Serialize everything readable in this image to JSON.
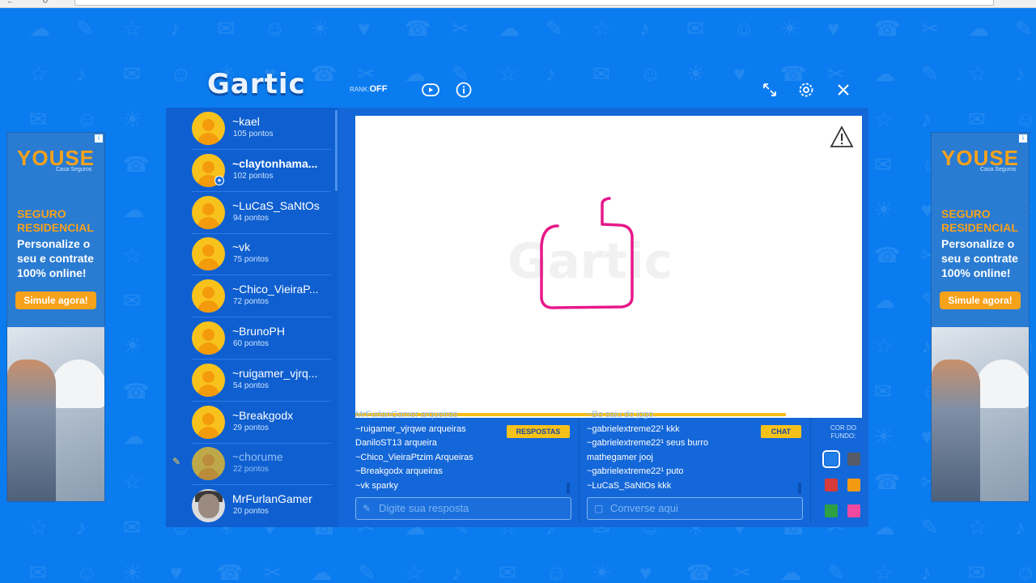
{
  "header": {
    "logo": "Gartic",
    "rank_label": "RANK:",
    "rank_value": "OFF",
    "icons": [
      "play-icon",
      "info-icon",
      "expand-icon",
      "settings-icon",
      "close-icon"
    ]
  },
  "players": [
    {
      "name": "~kael",
      "points": "105 pontos"
    },
    {
      "name": "~claytonhama...",
      "points": "102 pontos",
      "me": true
    },
    {
      "name": "~LuCaS_SaNtOs",
      "points": "94 pontos"
    },
    {
      "name": "~vk",
      "points": "75 pontos"
    },
    {
      "name": "~Chico_VieiraP...",
      "points": "72 pontos"
    },
    {
      "name": "~BrunoPH",
      "points": "60 pontos"
    },
    {
      "name": "~ruigamer_vjrq...",
      "points": "54 pontos"
    },
    {
      "name": "~Breakgodx",
      "points": "29 pontos"
    },
    {
      "name": "~chorume",
      "points": "22 pontos",
      "drawing": true
    },
    {
      "name": "MrFurlanGamer",
      "points": "20 pontos",
      "photo": true
    }
  ],
  "canvas": {
    "watermark": "Gartic",
    "stroke_color": "#e6198a",
    "timer_progress": 0.85
  },
  "answers": {
    "tag": "RESPOSTAS",
    "lines": [
      "MrFurlanGamer arqueiras",
      "~ruigamer_vjrqwe arqueiras",
      "DaniloST13 arqueira",
      "~Chico_VieiraPtzim Arqueiras",
      "~Breakgodx arqueiras",
      "~vk sparky"
    ],
    "placeholder": "Digite sua resposta"
  },
  "chat": {
    "tag": "CHAT",
    "lines": [
      "~Bo saiu do jogo.",
      "~gabrielextreme22¹ kkk",
      "~gabrielextreme22¹ seus burro",
      "mathegamer jooj",
      "~gabrielextreme22¹ puto",
      "~LuCaS_SaNtOs kkk"
    ],
    "placeholder": "Converse aqui"
  },
  "background_color": {
    "label": "COR DO FUNDO:",
    "swatches": [
      "#1f7ee8",
      "#555a66",
      "#d93a3a",
      "#f39a12",
      "#2ea043",
      "#ef4aa0"
    ],
    "selected": 0
  },
  "ads": {
    "brand": "YOUSE",
    "brand_sub": "Casa Seguros",
    "headline": "SEGURO RESIDENCIAL",
    "copy": "Personalize o seu e contrate 100% online!",
    "cta": "Simule agora!"
  },
  "colors": {
    "page_bg": "#0b7cf0",
    "panel": "#1467d8",
    "accent_yellow": "#f6c21a"
  }
}
